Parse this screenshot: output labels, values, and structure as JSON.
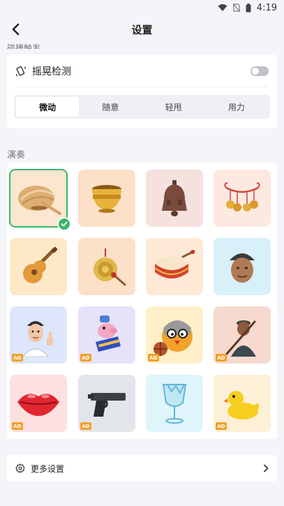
{
  "status_bar": {
    "time": "4:19",
    "icons": [
      "wifi-icon",
      "no-sim-icon",
      "battery-icon"
    ]
  },
  "header": {
    "title": "设置",
    "back_icon": "chevron-left-icon"
  },
  "clipped_section_label": "碰撞触发",
  "shake": {
    "label": "摇晃检测",
    "icon": "shake-icon",
    "enabled": false
  },
  "intensity": {
    "options": [
      "微动",
      "随意",
      "轻甩",
      "用力"
    ],
    "selected_index": 0
  },
  "play_section": {
    "title": "演奏",
    "ad_label": "AD",
    "instruments": [
      {
        "icon": "wooden-fish-icon",
        "ad": false,
        "selected": true,
        "bg": "#fbe6cf"
      },
      {
        "icon": "bowl-icon",
        "ad": false,
        "selected": false,
        "bg": "#fde0c8"
      },
      {
        "icon": "bell-icon",
        "ad": false,
        "selected": false,
        "bg": "#f5e1de"
      },
      {
        "icon": "bracelet-bells-icon",
        "ad": false,
        "selected": false,
        "bg": "#fde9e0"
      },
      {
        "icon": "guitar-icon",
        "ad": false,
        "selected": false,
        "bg": "#fde9c8"
      },
      {
        "icon": "gong-icon",
        "ad": false,
        "selected": false,
        "bg": "#fde0c8"
      },
      {
        "icon": "drum-icon",
        "ad": false,
        "selected": false,
        "bg": "#fde9d6"
      },
      {
        "icon": "man-with-hat-icon",
        "ad": false,
        "selected": false,
        "bg": "#d8f0fa"
      },
      {
        "icon": "man-thumbs-up-icon",
        "ad": true,
        "selected": false,
        "bg": "#dde6fb"
      },
      {
        "icon": "pig-character-icon",
        "ad": true,
        "selected": false,
        "bg": "#e6e2f9"
      },
      {
        "icon": "basketball-chicken-icon",
        "ad": true,
        "selected": false,
        "bg": "#fff0c9"
      },
      {
        "icon": "old-man-cane-icon",
        "ad": true,
        "selected": false,
        "bg": "#f6d9cf"
      },
      {
        "icon": "lips-icon",
        "ad": true,
        "selected": false,
        "bg": "#fde0e0"
      },
      {
        "icon": "pistol-icon",
        "ad": true,
        "selected": false,
        "bg": "#e2e5ea"
      },
      {
        "icon": "broken-glass-icon",
        "ad": false,
        "selected": false,
        "bg": "#dff4fb"
      },
      {
        "icon": "rubber-duck-icon",
        "ad": true,
        "selected": false,
        "bg": "#fdf0d6"
      }
    ]
  },
  "more_settings": {
    "label": "更多设置",
    "icon": "gear-icon",
    "arrow_icon": "chevron-right-icon"
  },
  "colors": {
    "accent_green": "#3bb56a",
    "ad_badge": "#f2a12b",
    "page_bg": "#f4f5f8"
  }
}
